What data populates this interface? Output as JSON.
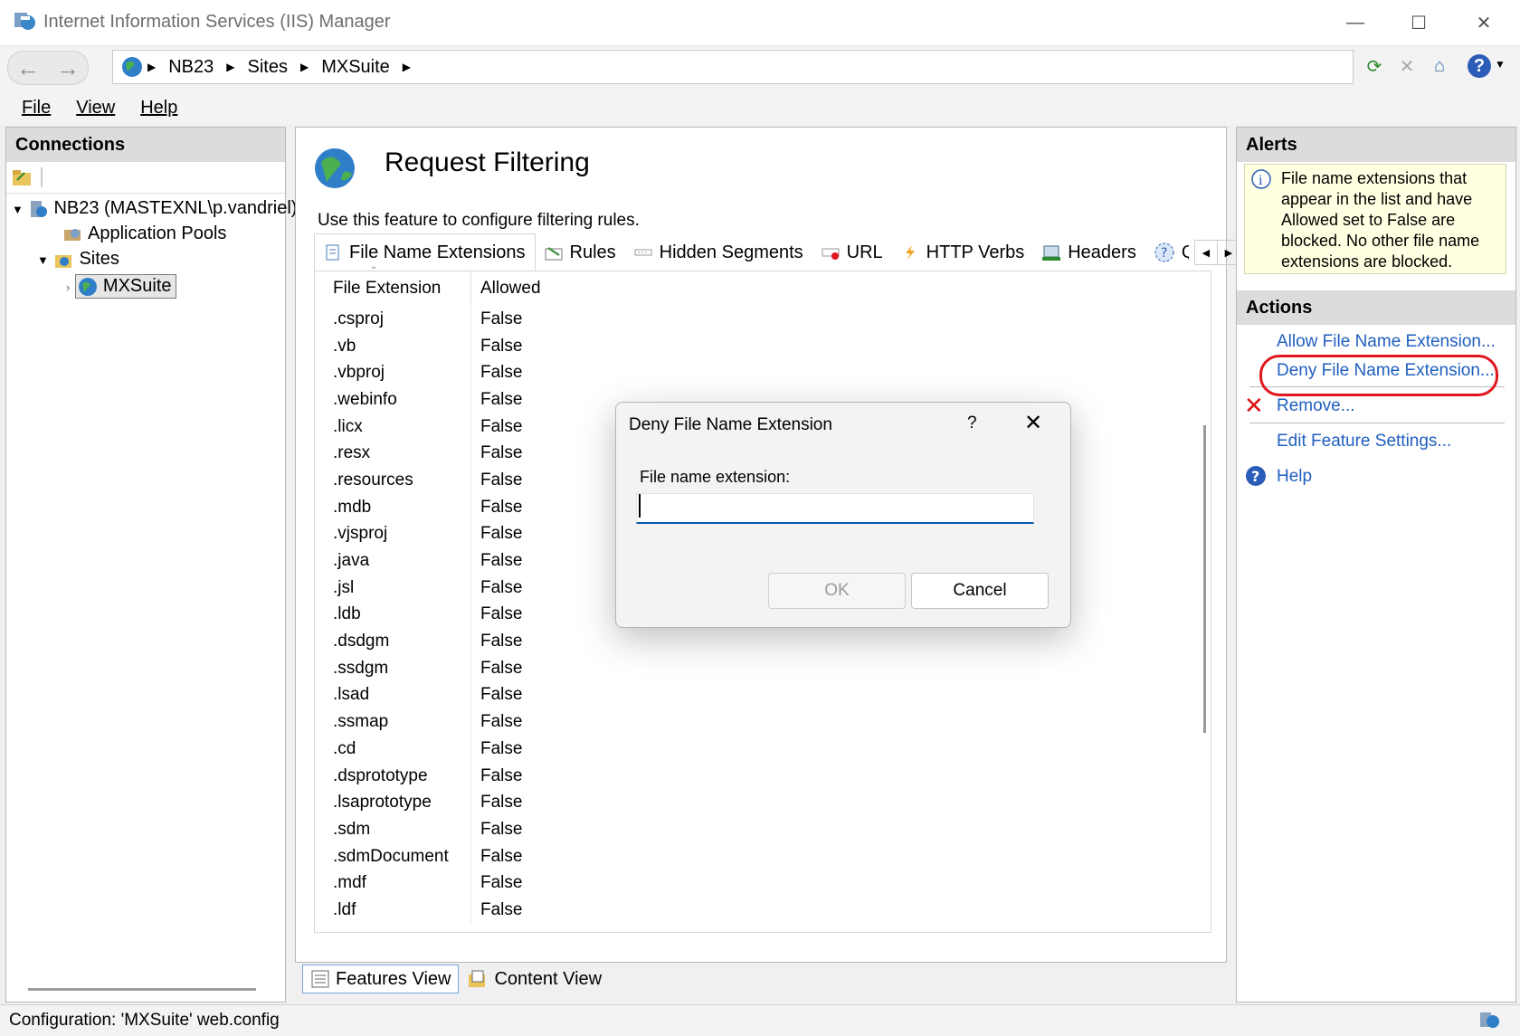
{
  "window": {
    "title": "Internet Information Services (IIS) Manager",
    "minimize": "—",
    "maximize": "☐",
    "close": "✕"
  },
  "addressbar": {
    "crumbs": [
      "NB23",
      "Sites",
      "MXSuite"
    ]
  },
  "menu": [
    {
      "label": "File"
    },
    {
      "label": "View"
    },
    {
      "label": "Help"
    }
  ],
  "connections": {
    "header": "Connections",
    "tree": {
      "server": "NB23 (MASTEXNL\\p.vandriel)",
      "app_pools": "Application Pools",
      "sites": "Sites",
      "site": "MXSuite"
    }
  },
  "feature": {
    "title": "Request Filtering",
    "description": "Use this feature to configure filtering rules.",
    "tabs": [
      "File Name Extensions",
      "Rules",
      "Hidden Segments",
      "URL",
      "HTTP Verbs",
      "Headers",
      "Q"
    ],
    "columns": [
      "File Extension",
      "Allowed"
    ],
    "rows": [
      [
        ".csproj",
        "False"
      ],
      [
        ".vb",
        "False"
      ],
      [
        ".vbproj",
        "False"
      ],
      [
        ".webinfo",
        "False"
      ],
      [
        ".licx",
        "False"
      ],
      [
        ".resx",
        "False"
      ],
      [
        ".resources",
        "False"
      ],
      [
        ".mdb",
        "False"
      ],
      [
        ".vjsproj",
        "False"
      ],
      [
        ".java",
        "False"
      ],
      [
        ".jsl",
        "False"
      ],
      [
        ".ldb",
        "False"
      ],
      [
        ".dsdgm",
        "False"
      ],
      [
        ".ssdgm",
        "False"
      ],
      [
        ".lsad",
        "False"
      ],
      [
        ".ssmap",
        "False"
      ],
      [
        ".cd",
        "False"
      ],
      [
        ".dsprototype",
        "False"
      ],
      [
        ".lsaprototype",
        "False"
      ],
      [
        ".sdm",
        "False"
      ],
      [
        ".sdmDocument",
        "False"
      ],
      [
        ".mdf",
        "False"
      ],
      [
        ".ldf",
        "False"
      ]
    ],
    "bottom_tabs": [
      "Features View",
      "Content View"
    ]
  },
  "alerts": {
    "header": "Alerts",
    "message": "File name extensions that appear in the list and have Allowed set to False are blocked. No other file name extensions are blocked."
  },
  "actions": {
    "header": "Actions",
    "allow": "Allow File Name Extension...",
    "deny": "Deny File Name Extension...",
    "remove": "Remove...",
    "edit": "Edit Feature Settings...",
    "help": "Help"
  },
  "status": {
    "text": "Configuration: 'MXSuite' web.config"
  },
  "dialog": {
    "title": "Deny File Name Extension",
    "help": "?",
    "close": "✕",
    "label": "File name extension:",
    "value": "",
    "ok": "OK",
    "cancel": "Cancel"
  },
  "colors": {
    "link": "#1f5fbf",
    "highlight": "#e0161e",
    "input_focus": "#0b5cad"
  }
}
